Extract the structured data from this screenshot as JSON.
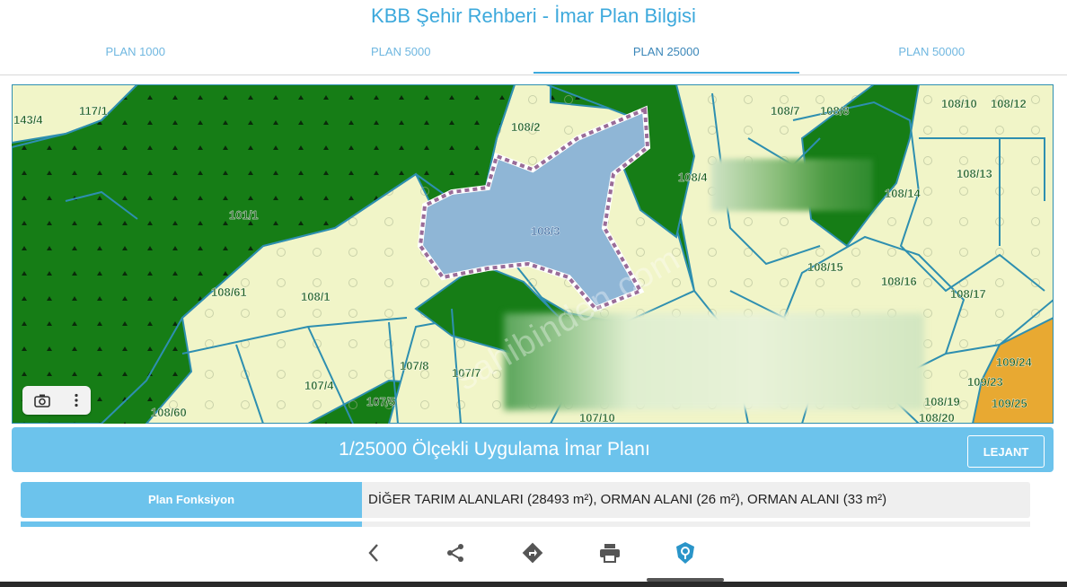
{
  "header": {
    "title": "KBB Şehir Rehberi - İmar Plan Bilgisi"
  },
  "tabs": [
    {
      "label": "PLAN 1000",
      "active": false
    },
    {
      "label": "PLAN 5000",
      "active": false
    },
    {
      "label": "PLAN 25000",
      "active": true
    },
    {
      "label": "PLAN 50000",
      "active": false
    }
  ],
  "map": {
    "parcel_labels": [
      "143/4",
      "117/1",
      "108/2",
      "108/7",
      "108/8",
      "108/10",
      "108/12",
      "108/4",
      "108/13",
      "108/14",
      "101/1",
      "108/3",
      "108/15",
      "108/61",
      "108/1",
      "108/16",
      "108/17",
      "107/8",
      "107/7",
      "107/4",
      "107/5",
      "108/60",
      "107/10",
      "109/24",
      "109/23",
      "109/25",
      "108/19",
      "108/20"
    ],
    "watermark": "sahibinden.com",
    "tools": {
      "camera_icon": "camera-icon",
      "menu_icon": "more-vertical-icon"
    },
    "colors": {
      "forest": "#167d16",
      "agri": "#f1f5c8",
      "selected": "#8fb6d6",
      "border": "#2e8fb0",
      "orange": "#e8a932"
    }
  },
  "plan": {
    "title": "1/25000 Ölçekli Uygulama İmar Planı",
    "legend_label": "LEJANT"
  },
  "info": {
    "label": "Plan Fonksiyon",
    "value": "DİĞER TARIM ALANLARI (28493 m²), ORMAN ALANI (26 m²), ORMAN ALANI (33 m²)"
  },
  "bottom_nav": [
    "chevron-left-icon",
    "share-icon",
    "directions-icon",
    "print-icon",
    "location-shield-icon"
  ],
  "accent_color": "#3da9dc"
}
